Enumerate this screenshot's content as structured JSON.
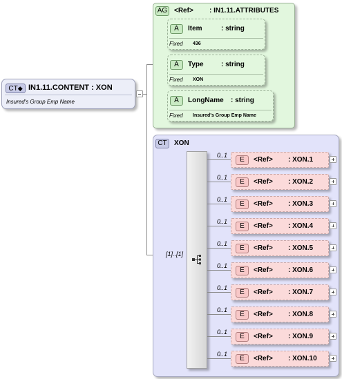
{
  "root": {
    "badge": "CT",
    "title": "IN1.11.CONTENT : XON",
    "description": "Insured's Group Emp Name"
  },
  "attribute_group": {
    "badge": "AG",
    "ref": "<Ref>",
    "name": ": IN1.11.ATTRIBUTES",
    "attributes": [
      {
        "badge": "A",
        "name": "Item",
        "type": ": string",
        "fixed_label": "Fixed",
        "fixed_value": "436"
      },
      {
        "badge": "A",
        "name": "Type",
        "type": ": string",
        "fixed_label": "Fixed",
        "fixed_value": "XON"
      },
      {
        "badge": "A",
        "name": "LongName",
        "type": ": string",
        "fixed_label": "Fixed",
        "fixed_value": "Insured's Group Emp Name"
      }
    ]
  },
  "complex_type": {
    "badge": "CT",
    "name": "XON",
    "multiplicity": "[1]..[1]",
    "elements": [
      {
        "badge": "E",
        "ref": "<Ref>",
        "name": ": XON.1",
        "occurs": "0..1"
      },
      {
        "badge": "E",
        "ref": "<Ref>",
        "name": ": XON.2",
        "occurs": "0..1"
      },
      {
        "badge": "E",
        "ref": "<Ref>",
        "name": ": XON.3",
        "occurs": "0..1"
      },
      {
        "badge": "E",
        "ref": "<Ref>",
        "name": ": XON.4",
        "occurs": "0..1"
      },
      {
        "badge": "E",
        "ref": "<Ref>",
        "name": ": XON.5",
        "occurs": "0..1"
      },
      {
        "badge": "E",
        "ref": "<Ref>",
        "name": ": XON.6",
        "occurs": "0..1"
      },
      {
        "badge": "E",
        "ref": "<Ref>",
        "name": ": XON.7",
        "occurs": "0..1"
      },
      {
        "badge": "E",
        "ref": "<Ref>",
        "name": ": XON.8",
        "occurs": "0..1"
      },
      {
        "badge": "E",
        "ref": "<Ref>",
        "name": ": XON.9",
        "occurs": "0..1"
      },
      {
        "badge": "E",
        "ref": "<Ref>",
        "name": ": XON.10",
        "occurs": "0..1"
      }
    ]
  },
  "colors": {
    "root_bg": "#eceef8",
    "root_border": "#9c9fb8",
    "ag_bg": "#e2f7de",
    "ag_border": "#9ab096",
    "attr_badge_bg": "#c9eac3",
    "ct_bg": "#e2e3fa",
    "ct_border": "#a6a8bf",
    "element_bg": "#fbdada",
    "element_border": "#c9a8a8",
    "element_badge_bg": "#f8c8c8"
  }
}
